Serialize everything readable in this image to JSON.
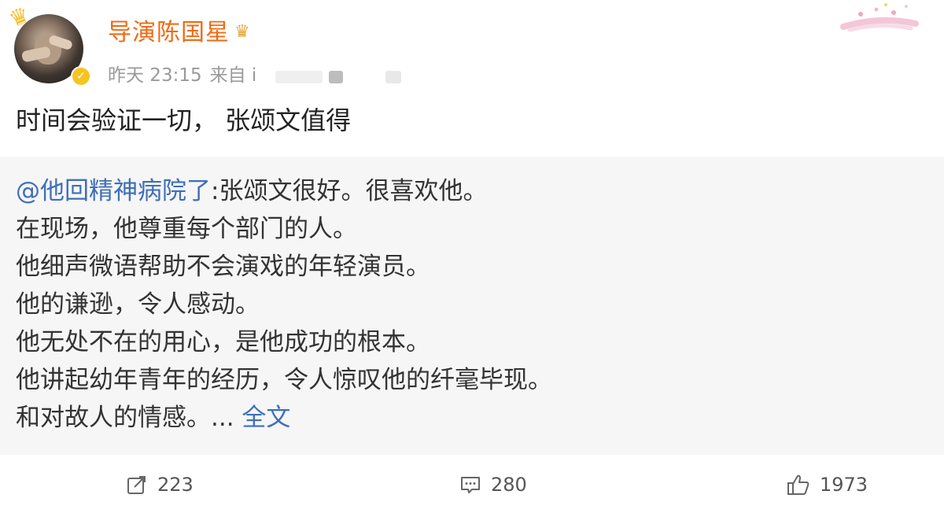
{
  "header": {
    "username": "导演陈国星",
    "time": "昨天 23:15",
    "source_prefix": "来自 i"
  },
  "post": {
    "text": "时间会验证一切， 张颂文值得"
  },
  "repost": {
    "mention": "@他回精神病院了",
    "lines": [
      ":张颂文很好。很喜欢他。",
      "在现场，他尊重每个部门的人。",
      "他细声微语帮助不会演戏的年轻演员。",
      "他的谦逊，令人感动。",
      "他无处不在的用心，是他成功的根本。",
      "他讲起幼年青年的经历，令人惊叹他的纤毫毕现。",
      "和对故人的情感。... "
    ],
    "full_text_link": "全文"
  },
  "actions": {
    "repost_count": "223",
    "comment_count": "280",
    "like_count": "1973"
  },
  "icons": {
    "verified": "verified-badge-icon",
    "crown": "crown-icon",
    "repost": "share-icon",
    "comment": "comment-icon",
    "like": "thumbs-up-icon"
  },
  "colors": {
    "username": "#f06a13",
    "link": "#3e6fb8",
    "repost_bg": "#f6f6f6",
    "meta": "#9a9a9a"
  }
}
